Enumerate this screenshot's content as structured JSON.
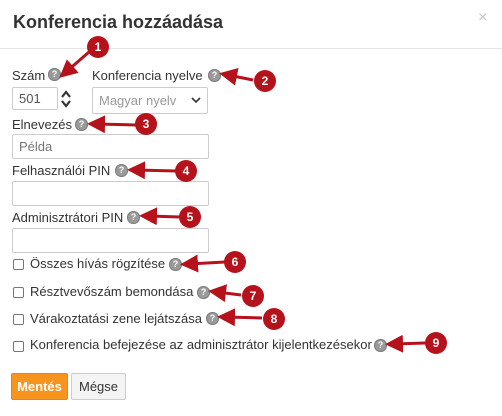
{
  "dialog": {
    "title": "Konferencia hozzáadása",
    "close_glyph": "×"
  },
  "fields": {
    "number_label": "Szám",
    "number_value": "501",
    "language_label": "Konferencia nyelve",
    "language_value": "Magyar nyelv",
    "name_label": "Elnevezés",
    "name_placeholder": "Példa",
    "user_pin_label": "Felhasználói PIN",
    "admin_pin_label": "Adminisztrátori PIN"
  },
  "checkboxes": [
    {
      "label": "Összes hívás rögzítése",
      "checked": false
    },
    {
      "label": "Résztvevőszám bemondása",
      "checked": false
    },
    {
      "label": "Várakoztatási zene lejátszása",
      "checked": false
    },
    {
      "label": "Konferencia befejezése az adminisztrátor kijelentkezésekor",
      "checked": false
    }
  ],
  "buttons": {
    "save": "Mentés",
    "cancel": "Mégse"
  },
  "help_glyph": "?",
  "annotations": [
    "1",
    "2",
    "3",
    "4",
    "5",
    "6",
    "7",
    "8",
    "9"
  ],
  "colors": {
    "save_button": "#f7941d",
    "annotation": "#b5121b",
    "help_icon": "#9a9a9a"
  }
}
